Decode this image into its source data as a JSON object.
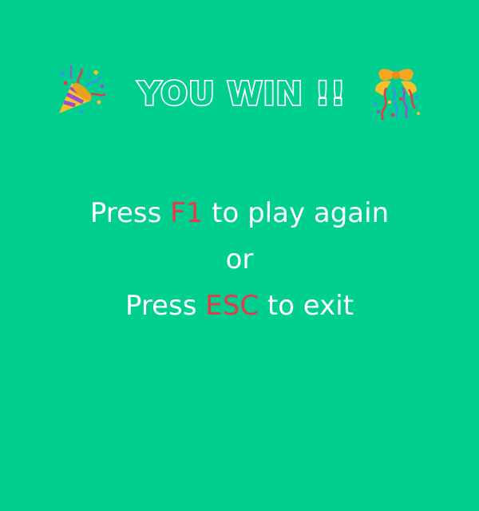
{
  "title": "YOU WIN !!",
  "icons": {
    "left": "party-popper-icon",
    "right": "confetti-ball-icon"
  },
  "instructions": {
    "line1": {
      "prefix": "Press ",
      "key": "F1",
      "suffix": " to play again"
    },
    "line2": "or",
    "line3": {
      "prefix": "Press ",
      "key": "ESC",
      "suffix": " to exit"
    }
  },
  "colors": {
    "background": "#00CF8F",
    "text": "#FFFFFF",
    "key_highlight": "#E8394A"
  }
}
